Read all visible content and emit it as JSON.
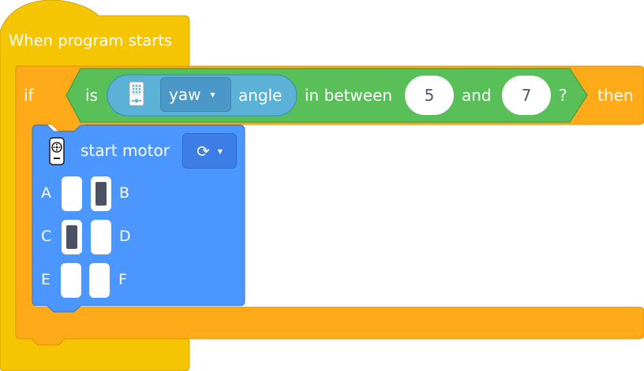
{
  "hat": {
    "label": "When program starts"
  },
  "if_block": {
    "if_label": "if",
    "then_label": "then",
    "condition": {
      "is_label": "is",
      "hub_icon": "hub-icon",
      "axis_dropdown": {
        "value": "yaw",
        "caret": "▾"
      },
      "angle_label": "angle",
      "between_label": "in between",
      "low_value": "5",
      "and_label": "and",
      "high_value": "7",
      "question_mark": "?"
    }
  },
  "motor_block": {
    "icon": "motor-icon",
    "label": "start motor",
    "direction": {
      "icon": "clockwise-arrow-icon",
      "glyph": "⟳",
      "caret": "▾"
    },
    "ports": [
      {
        "label": "A",
        "selected": false
      },
      {
        "label": "B",
        "selected": true
      },
      {
        "label": "C",
        "selected": true
      },
      {
        "label": "D",
        "selected": false
      },
      {
        "label": "E",
        "selected": false
      },
      {
        "label": "F",
        "selected": false
      }
    ]
  },
  "colors": {
    "event": "#f5c402",
    "control": "#ffab19",
    "operator": "#59c059",
    "sensor": "#5cb1d6",
    "motor": "#4c97ff"
  }
}
